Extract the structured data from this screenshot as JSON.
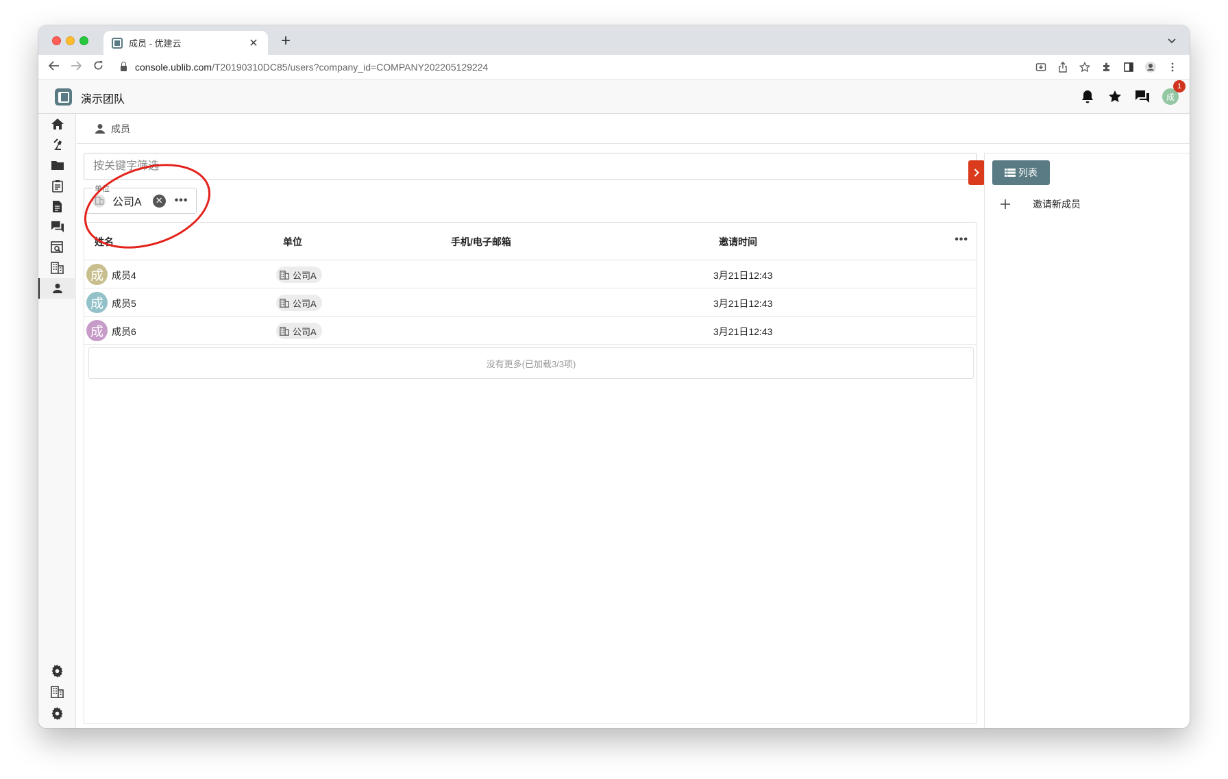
{
  "browser": {
    "tab_title": "成员 - 优建云",
    "close_glyph": "✕",
    "new_tab_glyph": "+",
    "url_host": "console.ublib.com",
    "url_path": "/T20190310DC85/users?company_id=COMPANY202205129224"
  },
  "app": {
    "title": "演示团队",
    "avatar_text": "成",
    "notification_count": "1"
  },
  "breadcrumb": {
    "label": "成员"
  },
  "filter": {
    "search_placeholder": "按关键字筛选",
    "field_label": "单位",
    "selected_value": "公司A",
    "clear_glyph": "✕",
    "more_glyph": "•••"
  },
  "table": {
    "columns": [
      "姓名",
      "单位",
      "手机/电子邮箱",
      "邀请时间"
    ],
    "more_glyph": "•••",
    "rows": [
      {
        "avatar": "成",
        "avatar_color": "#c9bf8e",
        "name": "成员4",
        "unit": "公司A",
        "contact": "",
        "invite_time": "3月21日12:43"
      },
      {
        "avatar": "成",
        "avatar_color": "#92c1c9",
        "name": "成员5",
        "unit": "公司A",
        "contact": "",
        "invite_time": "3月21日12:43"
      },
      {
        "avatar": "成",
        "avatar_color": "#c79bc8",
        "name": "成员6",
        "unit": "公司A",
        "contact": "",
        "invite_time": "3月21日12:43"
      }
    ],
    "footer": "没有更多(已加载3/3项)"
  },
  "right_panel": {
    "list_button": "列表",
    "invite_label": "邀请新成员"
  },
  "colors": {
    "brand": "#5a7b83",
    "accent_red": "#d93b1c",
    "annotation": "#e3221b"
  }
}
